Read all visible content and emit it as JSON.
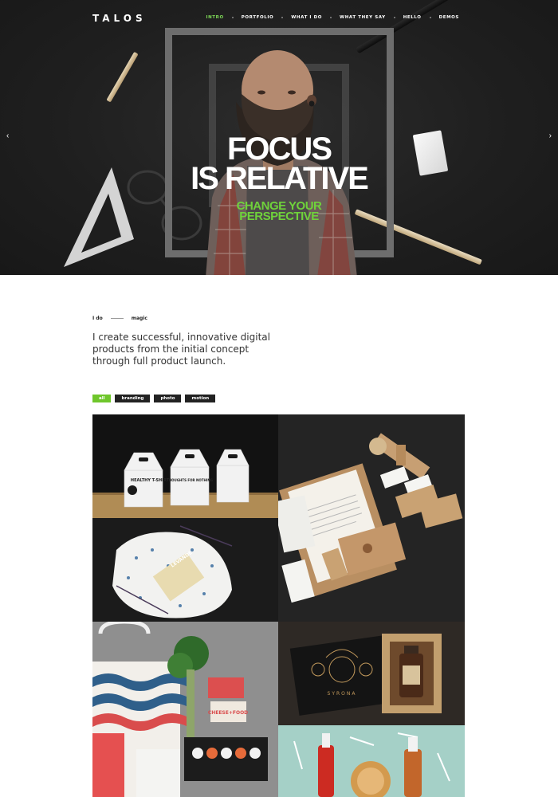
{
  "brand": {
    "logo": "TALOS"
  },
  "nav": {
    "items": [
      {
        "label": "INTRO",
        "active": true
      },
      {
        "label": "PORTFOLIO",
        "active": false
      },
      {
        "label": "WHAT I DO",
        "active": false
      },
      {
        "label": "WHAT THEY SAY",
        "active": false
      },
      {
        "label": "HELLO",
        "active": false
      },
      {
        "label": "DEMOS",
        "active": false
      }
    ]
  },
  "hero": {
    "title_line1": "FOCUS",
    "title_line2": "IS RELATIVE",
    "subtitle_line1": "CHANGE YOUR",
    "subtitle_line2": "PERSPECTIVE",
    "prev_arrow": "‹",
    "next_arrow": "›"
  },
  "intro": {
    "label_left": "I do",
    "label_right": "magic",
    "tagline": "I create successful, innovative digital products from the initial concept through full product launch."
  },
  "filters": {
    "items": [
      {
        "label": "all",
        "active": true
      },
      {
        "label": "branding",
        "active": false
      },
      {
        "label": "photo",
        "active": false
      },
      {
        "label": "motion",
        "active": false
      }
    ]
  },
  "portfolio": {
    "tile1": {
      "box_text_1": "HEALTHY T-SHIRT",
      "box_text_2": "THOUGHTS FOR NOTHING"
    },
    "tile3": {
      "soap_text": "LEVANDE"
    },
    "tile4": {
      "card_text": "CHEESE+FOOD"
    },
    "tile5": {
      "brand_text": "SYRONA"
    }
  },
  "colors": {
    "accent_green": "#6fc62b",
    "nav_active": "#7ed957",
    "hero_bg": "#1f1f1f"
  }
}
